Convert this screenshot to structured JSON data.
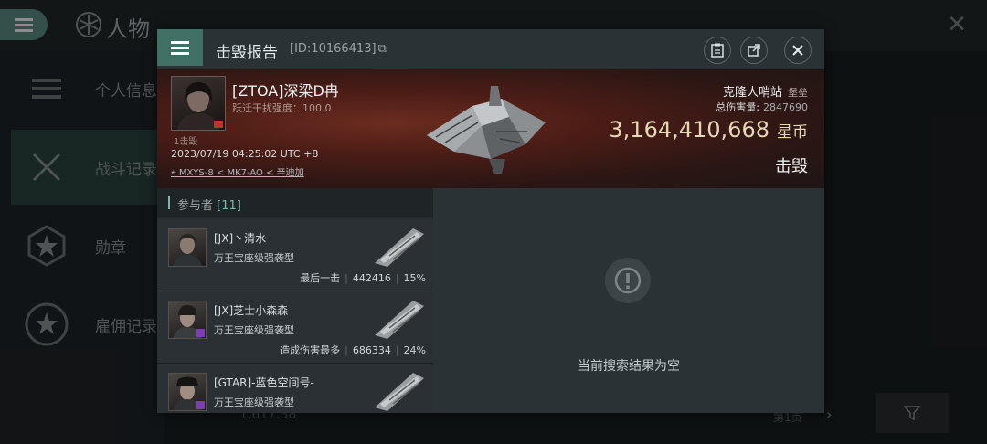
{
  "background": {
    "title": "人物",
    "sidebar": [
      {
        "label": "个人信息",
        "icon": "list-icon"
      },
      {
        "label": "战斗记录",
        "icon": "crossed-swords-icon"
      },
      {
        "label": "勋章",
        "icon": "star-icon"
      },
      {
        "label": "雇佣记录",
        "icon": "star-wreath-icon"
      }
    ],
    "bottom_value": "1,617.38",
    "page_text": "第1页"
  },
  "dialog": {
    "title": "击毁报告",
    "report_id": "[ID:10166413]",
    "victim": {
      "name": "[ZTOA]深梁D冉",
      "interference": "跃迁干扰强度：100.0",
      "status_small": "1击毁",
      "time": "2023/07/19 04:25:02 UTC +8",
      "location": "MXYS-8 < MK7-AO < 辛迪加"
    },
    "ship": {
      "name": "克隆人哨站",
      "class": "堡垒",
      "damage_label": "总伤害量:",
      "damage_value": "2847690",
      "isk_value": "3,164,410,668",
      "isk_unit": "星币",
      "result": "击毁"
    },
    "participants": {
      "title": "参与者",
      "count": "[11]",
      "rows": [
        {
          "name": "[JX]丶清水",
          "ship": "万王宝座级强袭型",
          "stat_label": "最后一击",
          "damage": "442416",
          "percent": "15%"
        },
        {
          "name": "[JX]芝士小森森",
          "ship": "万王宝座级强袭型",
          "stat_label": "造成伤害最多",
          "damage": "686334",
          "percent": "24%"
        },
        {
          "name": "[GTAR]-蓝色空间号-",
          "ship": "万王宝座级强袭型",
          "stat_label": "",
          "damage": "",
          "percent": ""
        }
      ]
    },
    "empty_message": "当前搜索结果为空"
  },
  "colors": {
    "accent": "#5d9487",
    "isk": "#e7d8b5",
    "banner": "#4a1c16"
  }
}
